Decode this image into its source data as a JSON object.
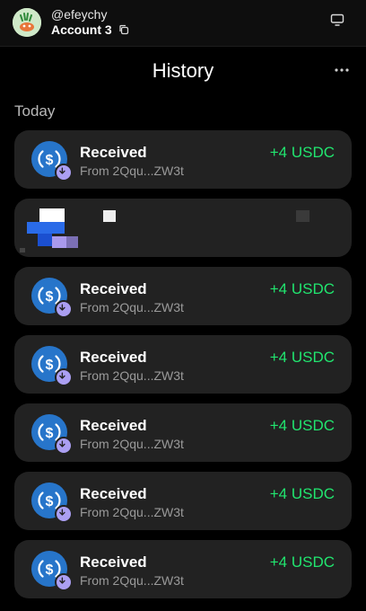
{
  "header": {
    "handle": "@efeychy",
    "account_name": "Account 3",
    "copy_icon": "copy-icon",
    "display_icon": "monitor-icon"
  },
  "page": {
    "title": "History",
    "more_icon": "more-horizontal-icon"
  },
  "section_label": "Today",
  "colors": {
    "background": "#000000",
    "card": "#222222",
    "positive_amount": "#21e56f",
    "usdc_blue": "#2775ca",
    "receive_badge": "#ab9ff2"
  },
  "transactions": [
    {
      "title": "Received",
      "subtitle": "From 2Qqu...ZW3t",
      "amount": "+4 USDC",
      "token_icon": "usdc-icon",
      "badge_icon": "arrow-down-icon"
    },
    {
      "obscured": true
    },
    {
      "title": "Received",
      "subtitle": "From 2Qqu...ZW3t",
      "amount": "+4 USDC",
      "token_icon": "usdc-icon",
      "badge_icon": "arrow-down-icon"
    },
    {
      "title": "Received",
      "subtitle": "From 2Qqu...ZW3t",
      "amount": "+4 USDC",
      "token_icon": "usdc-icon",
      "badge_icon": "arrow-down-icon"
    },
    {
      "title": "Received",
      "subtitle": "From 2Qqu...ZW3t",
      "amount": "+4 USDC",
      "token_icon": "usdc-icon",
      "badge_icon": "arrow-down-icon"
    },
    {
      "title": "Received",
      "subtitle": "From 2Qqu...ZW3t",
      "amount": "+4 USDC",
      "token_icon": "usdc-icon",
      "badge_icon": "arrow-down-icon"
    },
    {
      "title": "Received",
      "subtitle": "From 2Qqu...ZW3t",
      "amount": "+4 USDC",
      "token_icon": "usdc-icon",
      "badge_icon": "arrow-down-icon"
    }
  ]
}
